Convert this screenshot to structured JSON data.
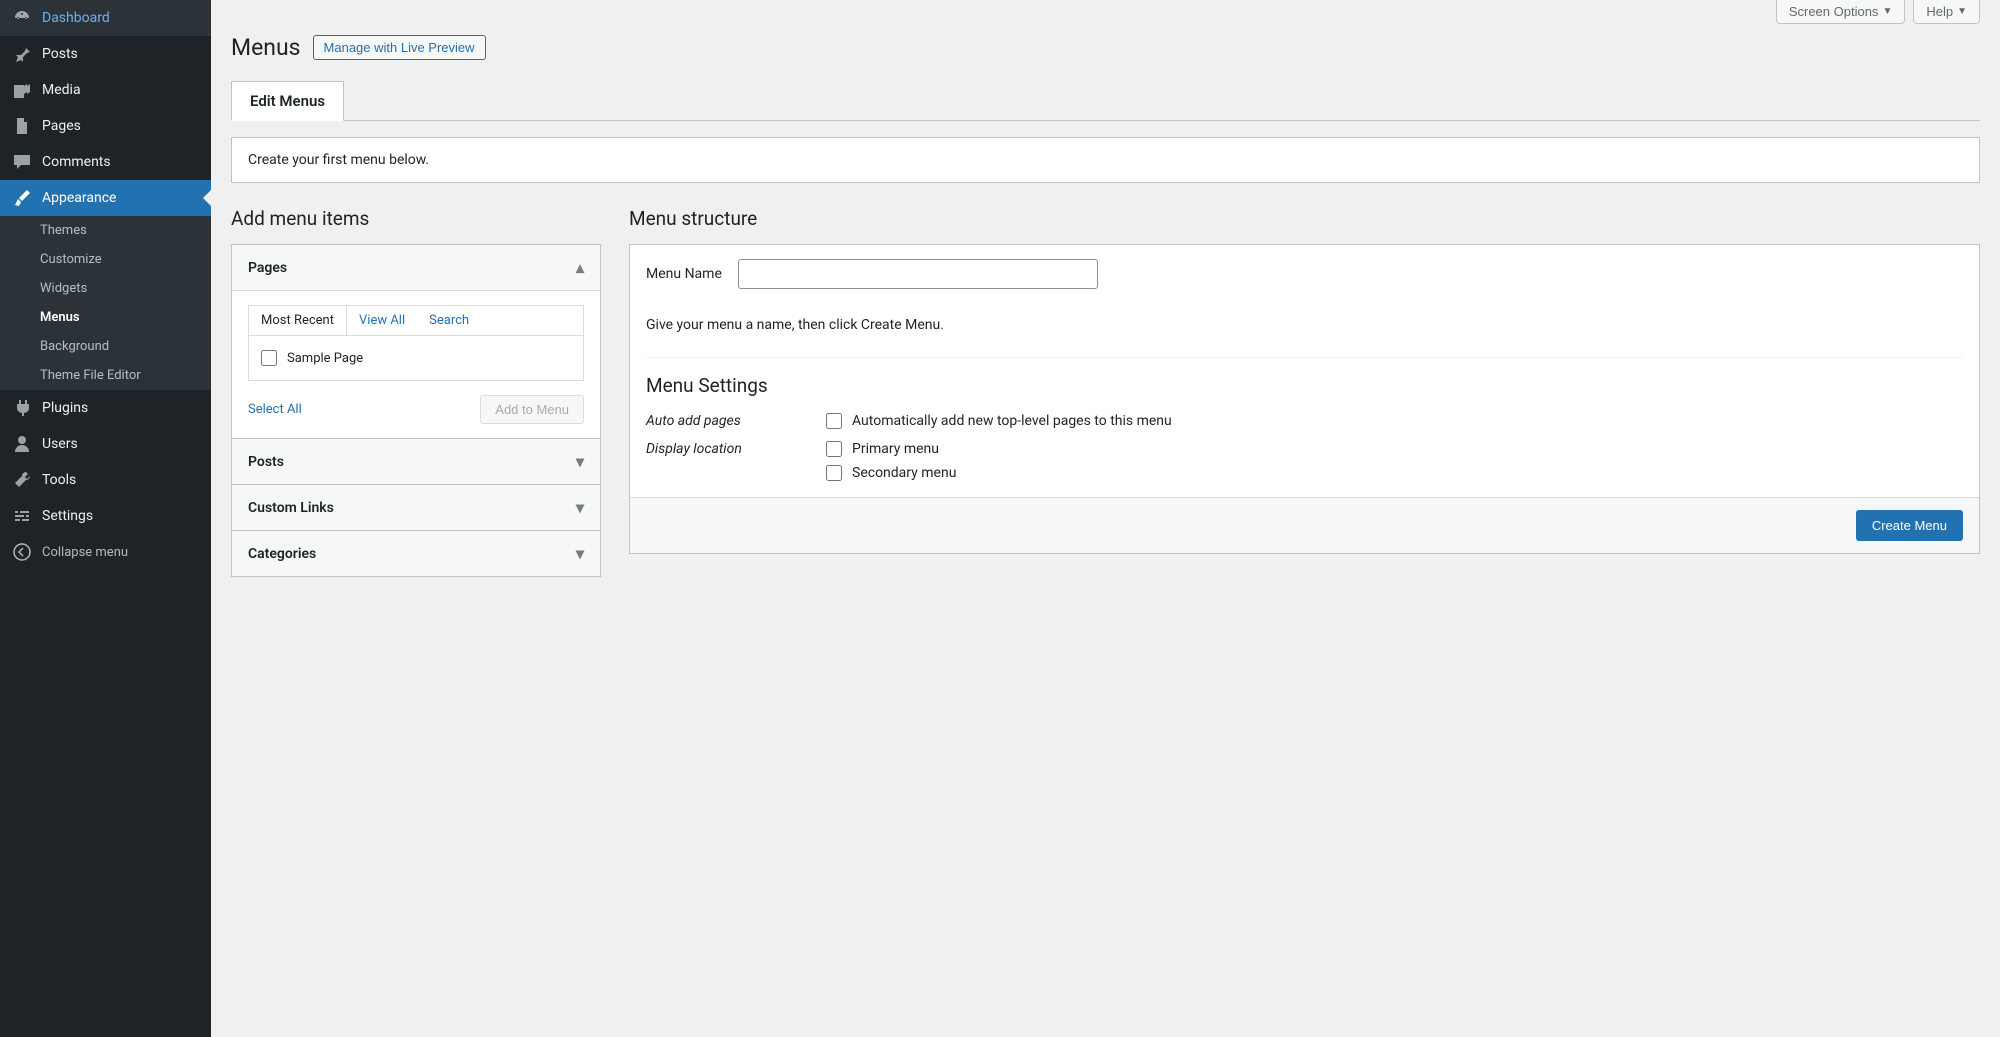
{
  "sidebar": {
    "items": [
      {
        "label": "Dashboard",
        "icon": "dashboard"
      },
      {
        "label": "Posts",
        "icon": "pin"
      },
      {
        "label": "Media",
        "icon": "media"
      },
      {
        "label": "Pages",
        "icon": "page"
      },
      {
        "label": "Comments",
        "icon": "comment"
      },
      {
        "label": "Appearance",
        "icon": "brush",
        "active": true
      },
      {
        "label": "Plugins",
        "icon": "plugin"
      },
      {
        "label": "Users",
        "icon": "user"
      },
      {
        "label": "Tools",
        "icon": "tools"
      },
      {
        "label": "Settings",
        "icon": "settings"
      }
    ],
    "submenu": [
      "Themes",
      "Customize",
      "Widgets",
      "Menus",
      "Background",
      "Theme File Editor"
    ],
    "submenu_current": "Menus",
    "collapse": "Collapse menu"
  },
  "topbar": {
    "screen_options": "Screen Options",
    "help": "Help"
  },
  "heading": {
    "title": "Menus",
    "preview_btn": "Manage with Live Preview"
  },
  "tabs": {
    "edit": "Edit Menus"
  },
  "notice": "Create your first menu below.",
  "left": {
    "title": "Add menu items",
    "accordions": [
      "Pages",
      "Posts",
      "Custom Links",
      "Categories"
    ],
    "inner_tabs": [
      "Most Recent",
      "View All",
      "Search"
    ],
    "sample_page": "Sample Page",
    "select_all": "Select All",
    "add_to_menu": "Add to Menu"
  },
  "right": {
    "title": "Menu structure",
    "menu_name_label": "Menu Name",
    "menu_name_value": "",
    "instruction": "Give your menu a name, then click Create Menu.",
    "settings_title": "Menu Settings",
    "auto_add_label": "Auto add pages",
    "auto_add_option": "Automatically add new top-level pages to this menu",
    "display_label": "Display location",
    "display_options": [
      "Primary menu",
      "Secondary menu"
    ],
    "create_btn": "Create Menu"
  }
}
